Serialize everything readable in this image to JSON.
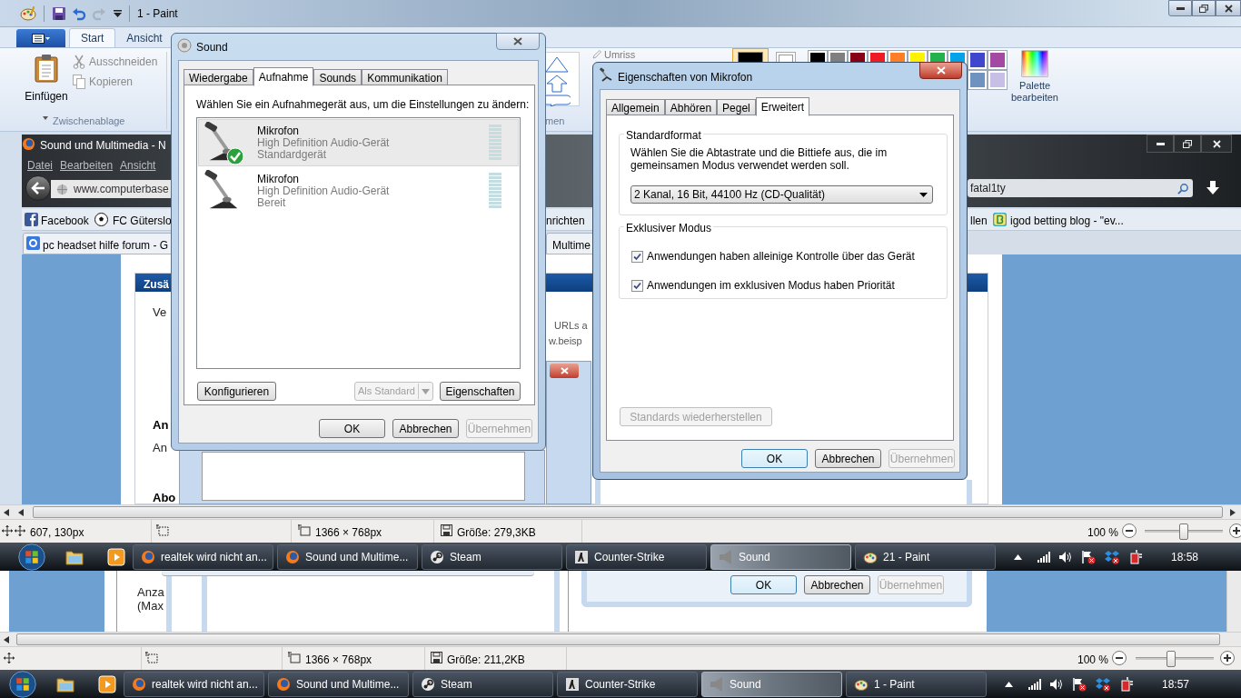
{
  "paint": {
    "title": "1 - Paint"
  },
  "ribbon": {
    "tabs": [
      {
        "label": "Start",
        "selected": true
      },
      {
        "label": "Ansicht",
        "selected": false
      }
    ],
    "clipboard": {
      "paste": "Einfügen",
      "cut": "Ausschneiden",
      "copy": "Kopieren",
      "label": "Zwischenablage"
    },
    "shapes_label": "men",
    "outline": "Umriss",
    "edit_palette": "Palette bearbeiten"
  },
  "browser": {
    "title": "Sound und Multimedia - N",
    "menu": [
      "Datei",
      "Bearbeiten",
      "Ansicht"
    ],
    "address": "www.computerbase",
    "search": "fatal1ty",
    "bookmarks": [
      "Facebook",
      "FC Güterslo",
      "nrichten",
      "llen",
      "igod betting blog - \"ev..."
    ],
    "tabs": [
      "pc headset hilfe forum - G",
      "Multime"
    ],
    "page": {
      "header": "Zusä",
      "intro": "Ve",
      "hint_1": "URLs a",
      "hint_2": "w.beisp",
      "heading_1": "An",
      "label_1": "An",
      "heading_2": "Abo"
    }
  },
  "sound": {
    "title": "Sound",
    "tabs": [
      {
        "label": "Wiedergabe",
        "selected": false
      },
      {
        "label": "Aufnahme",
        "selected": true
      },
      {
        "label": "Sounds",
        "selected": false
      },
      {
        "label": "Kommunikation",
        "selected": false
      }
    ],
    "instruction": "Wählen Sie ein Aufnahmegerät aus, um die Einstellungen zu ändern:",
    "devices": [
      {
        "name": "Mikrofon",
        "driver": "High Definition Audio-Gerät",
        "status": "Standardgerät",
        "default": true,
        "selected": true
      },
      {
        "name": "Mikrofon",
        "driver": "High Definition Audio-Gerät",
        "status": "Bereit",
        "default": false,
        "selected": false
      }
    ],
    "configure": "Konfigurieren",
    "set_default": {
      "label": "Als Standard",
      "disabled": true
    },
    "properties": "Eigenschaften",
    "footer": [
      {
        "label": "OK",
        "disabled": false
      },
      {
        "label": "Abbrechen",
        "disabled": false
      },
      {
        "label": "Übernehmen",
        "disabled": true
      }
    ]
  },
  "mic": {
    "title": "Eigenschaften von Mikrofon",
    "tabs": [
      {
        "label": "Allgemein",
        "selected": false
      },
      {
        "label": "Abhören",
        "selected": false
      },
      {
        "label": "Pegel",
        "selected": false
      },
      {
        "label": "Erweitert",
        "selected": true
      }
    ],
    "format_group": "Standardformat",
    "format_text": "Wählen Sie die Abtastrate und die Bittiefe aus, die im gemeinsamen Modus verwendet werden soll.",
    "format": "2 Kanal, 16 Bit, 44100 Hz (CD-Qualität)",
    "exclusive_group": "Exklusiver Modus",
    "options": [
      {
        "label": "Anwendungen haben alleinige Kontrolle über das Gerät",
        "checked": true
      },
      {
        "label": "Anwendungen im exklusiven Modus haben Priorität",
        "checked": true
      }
    ],
    "restore": {
      "label": "Standards wiederherstellen",
      "disabled": true
    },
    "footer": [
      {
        "label": "OK",
        "disabled": false
      },
      {
        "label": "Abbrechen",
        "disabled": false
      },
      {
        "label": "Übernehmen",
        "disabled": true
      }
    ]
  },
  "status_bar": {
    "position": "607, 130px",
    "dimensions": "1366 × 768px",
    "file_size": "Größe: 279,3KB",
    "zoom": "100 %",
    "level": 0.5
  },
  "taskbar": {
    "items": [
      {
        "label": "realtek wird nicht an...",
        "kind": "browser",
        "selected": false
      },
      {
        "label": "Sound und Multime...",
        "kind": "browser",
        "selected": false
      },
      {
        "label": "Steam",
        "kind": "steam",
        "selected": false
      },
      {
        "label": "Counter-Strike",
        "kind": "game",
        "selected": false
      },
      {
        "label": "Sound",
        "kind": "sound",
        "selected": true
      },
      {
        "label": "21 - Paint",
        "kind": "paint",
        "selected": false
      }
    ],
    "clock": "18:58"
  },
  "old_canvas": {
    "texts": [
      "Anza",
      "(Max"
    ],
    "footer": [
      {
        "label": "OK",
        "disabled": false
      },
      {
        "label": "Abbrechen",
        "disabled": false
      },
      {
        "label": "Übernehmen",
        "disabled": true
      }
    ]
  },
  "old_status_bar": {
    "dimensions": "1366 × 768px",
    "file_size": "Größe: 211,2KB",
    "zoom": "100 %",
    "level": 0.45
  },
  "old_taskbar": {
    "items": [
      {
        "label": "realtek wird nicht an...",
        "kind": "browser",
        "selected": false
      },
      {
        "label": "Sound und Multime...",
        "kind": "browser",
        "selected": false
      },
      {
        "label": "Steam",
        "kind": "steam",
        "selected": false
      },
      {
        "label": "Counter-Strike",
        "kind": "game",
        "selected": false
      },
      {
        "label": "Sound",
        "kind": "sound",
        "selected": true
      },
      {
        "label": "1 - Paint",
        "kind": "paint",
        "selected": false
      }
    ],
    "clock": "18:57"
  }
}
